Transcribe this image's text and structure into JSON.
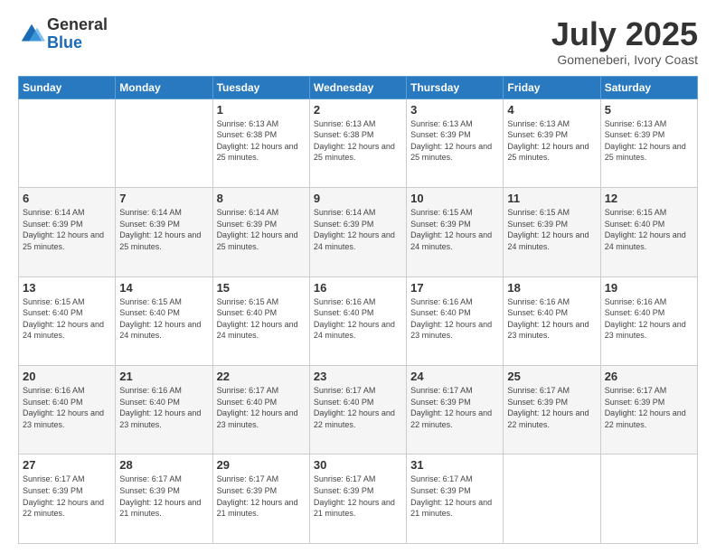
{
  "logo": {
    "general": "General",
    "blue": "Blue"
  },
  "header": {
    "month": "July 2025",
    "location": "Gomeneberi, Ivory Coast"
  },
  "weekdays": [
    "Sunday",
    "Monday",
    "Tuesday",
    "Wednesday",
    "Thursday",
    "Friday",
    "Saturday"
  ],
  "weeks": [
    [
      {
        "day": "",
        "info": ""
      },
      {
        "day": "",
        "info": ""
      },
      {
        "day": "1",
        "info": "Sunrise: 6:13 AM\nSunset: 6:38 PM\nDaylight: 12 hours and 25 minutes."
      },
      {
        "day": "2",
        "info": "Sunrise: 6:13 AM\nSunset: 6:38 PM\nDaylight: 12 hours and 25 minutes."
      },
      {
        "day": "3",
        "info": "Sunrise: 6:13 AM\nSunset: 6:39 PM\nDaylight: 12 hours and 25 minutes."
      },
      {
        "day": "4",
        "info": "Sunrise: 6:13 AM\nSunset: 6:39 PM\nDaylight: 12 hours and 25 minutes."
      },
      {
        "day": "5",
        "info": "Sunrise: 6:13 AM\nSunset: 6:39 PM\nDaylight: 12 hours and 25 minutes."
      }
    ],
    [
      {
        "day": "6",
        "info": "Sunrise: 6:14 AM\nSunset: 6:39 PM\nDaylight: 12 hours and 25 minutes."
      },
      {
        "day": "7",
        "info": "Sunrise: 6:14 AM\nSunset: 6:39 PM\nDaylight: 12 hours and 25 minutes."
      },
      {
        "day": "8",
        "info": "Sunrise: 6:14 AM\nSunset: 6:39 PM\nDaylight: 12 hours and 25 minutes."
      },
      {
        "day": "9",
        "info": "Sunrise: 6:14 AM\nSunset: 6:39 PM\nDaylight: 12 hours and 24 minutes."
      },
      {
        "day": "10",
        "info": "Sunrise: 6:15 AM\nSunset: 6:39 PM\nDaylight: 12 hours and 24 minutes."
      },
      {
        "day": "11",
        "info": "Sunrise: 6:15 AM\nSunset: 6:39 PM\nDaylight: 12 hours and 24 minutes."
      },
      {
        "day": "12",
        "info": "Sunrise: 6:15 AM\nSunset: 6:40 PM\nDaylight: 12 hours and 24 minutes."
      }
    ],
    [
      {
        "day": "13",
        "info": "Sunrise: 6:15 AM\nSunset: 6:40 PM\nDaylight: 12 hours and 24 minutes."
      },
      {
        "day": "14",
        "info": "Sunrise: 6:15 AM\nSunset: 6:40 PM\nDaylight: 12 hours and 24 minutes."
      },
      {
        "day": "15",
        "info": "Sunrise: 6:15 AM\nSunset: 6:40 PM\nDaylight: 12 hours and 24 minutes."
      },
      {
        "day": "16",
        "info": "Sunrise: 6:16 AM\nSunset: 6:40 PM\nDaylight: 12 hours and 24 minutes."
      },
      {
        "day": "17",
        "info": "Sunrise: 6:16 AM\nSunset: 6:40 PM\nDaylight: 12 hours and 23 minutes."
      },
      {
        "day": "18",
        "info": "Sunrise: 6:16 AM\nSunset: 6:40 PM\nDaylight: 12 hours and 23 minutes."
      },
      {
        "day": "19",
        "info": "Sunrise: 6:16 AM\nSunset: 6:40 PM\nDaylight: 12 hours and 23 minutes."
      }
    ],
    [
      {
        "day": "20",
        "info": "Sunrise: 6:16 AM\nSunset: 6:40 PM\nDaylight: 12 hours and 23 minutes."
      },
      {
        "day": "21",
        "info": "Sunrise: 6:16 AM\nSunset: 6:40 PM\nDaylight: 12 hours and 23 minutes."
      },
      {
        "day": "22",
        "info": "Sunrise: 6:17 AM\nSunset: 6:40 PM\nDaylight: 12 hours and 23 minutes."
      },
      {
        "day": "23",
        "info": "Sunrise: 6:17 AM\nSunset: 6:40 PM\nDaylight: 12 hours and 22 minutes."
      },
      {
        "day": "24",
        "info": "Sunrise: 6:17 AM\nSunset: 6:39 PM\nDaylight: 12 hours and 22 minutes."
      },
      {
        "day": "25",
        "info": "Sunrise: 6:17 AM\nSunset: 6:39 PM\nDaylight: 12 hours and 22 minutes."
      },
      {
        "day": "26",
        "info": "Sunrise: 6:17 AM\nSunset: 6:39 PM\nDaylight: 12 hours and 22 minutes."
      }
    ],
    [
      {
        "day": "27",
        "info": "Sunrise: 6:17 AM\nSunset: 6:39 PM\nDaylight: 12 hours and 22 minutes."
      },
      {
        "day": "28",
        "info": "Sunrise: 6:17 AM\nSunset: 6:39 PM\nDaylight: 12 hours and 21 minutes."
      },
      {
        "day": "29",
        "info": "Sunrise: 6:17 AM\nSunset: 6:39 PM\nDaylight: 12 hours and 21 minutes."
      },
      {
        "day": "30",
        "info": "Sunrise: 6:17 AM\nSunset: 6:39 PM\nDaylight: 12 hours and 21 minutes."
      },
      {
        "day": "31",
        "info": "Sunrise: 6:17 AM\nSunset: 6:39 PM\nDaylight: 12 hours and 21 minutes."
      },
      {
        "day": "",
        "info": ""
      },
      {
        "day": "",
        "info": ""
      }
    ]
  ]
}
